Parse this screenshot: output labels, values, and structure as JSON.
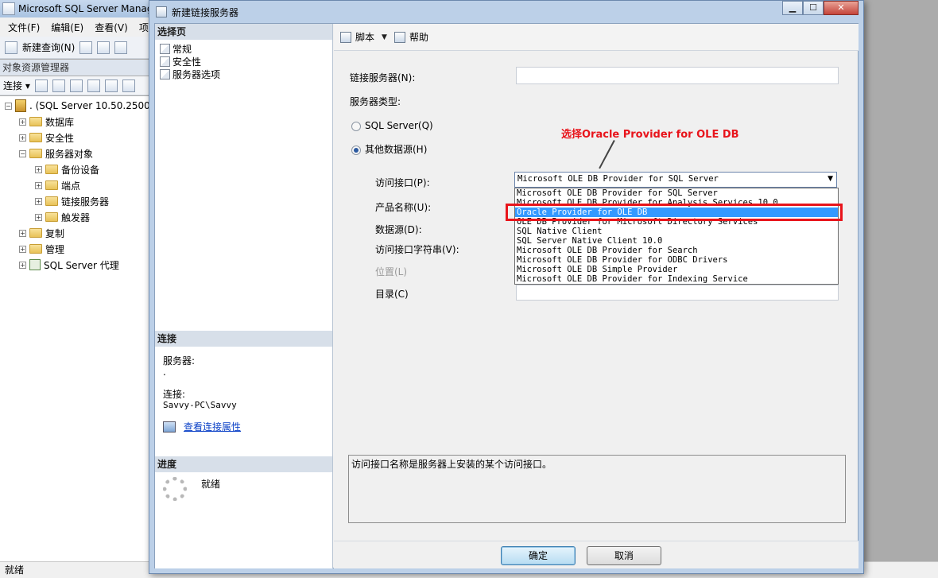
{
  "ssms": {
    "title": "Microsoft SQL Server Manag",
    "menu": [
      "文件(F)",
      "编辑(E)",
      "查看(V)",
      "项"
    ],
    "toolbar_new_query": "新建查询(N)",
    "object_explorer_title": "对象资源管理器",
    "connect_label": "连接",
    "tree": {
      "server": ". (SQL Server 10.50.2500",
      "databases": "数据库",
      "security": "安全性",
      "server_objects": "服务器对象",
      "backup_devices": "备份设备",
      "endpoints": "端点",
      "linked_servers": "链接服务器",
      "triggers": "触发器",
      "replication": "复制",
      "management": "管理",
      "agent": "SQL Server 代理"
    },
    "status": "就绪"
  },
  "dialog": {
    "title": "新建链接服务器",
    "left": {
      "select_page_header": "选择页",
      "pages": [
        "常规",
        "安全性",
        "服务器选项"
      ],
      "connection_header": "连接",
      "server_label": "服务器:",
      "server_value": ".",
      "connection_label": "连接:",
      "connection_value": "Savvy-PC\\Savvy",
      "view_props_link": "查看连接属性",
      "progress_header": "进度",
      "progress_status": "就绪"
    },
    "toolbar": {
      "script": "脚本",
      "help": "帮助"
    },
    "form": {
      "linked_server_label": "链接服务器(N):",
      "server_type_label": "服务器类型:",
      "radio_sql_server": "SQL Server(Q)",
      "radio_other": "其他数据源(H)",
      "provider_label": "访问接口(P):",
      "product_name_label": "产品名称(U):",
      "data_source_label": "数据源(D):",
      "provider_string_label": "访问接口字符串(V):",
      "location_label": "位置(L)",
      "catalog_label": "目录(C)",
      "provider_selected": "Microsoft OLE DB Provider for SQL Server",
      "provider_options": [
        "Microsoft OLE DB Provider for SQL Server",
        "Microsoft OLE DB Provider for Analysis Services 10.0",
        "Oracle Provider for OLE DB",
        "OLE DB Provider for Microsoft Directory Services",
        "SQL Native Client",
        "SQL Server Native Client 10.0",
        "Microsoft OLE DB Provider for Search",
        "Microsoft OLE DB Provider for ODBC Drivers",
        "Microsoft OLE DB Simple Provider",
        "Microsoft OLE DB Provider for Indexing Service"
      ],
      "highlighted_index": 2
    },
    "annotation": "选择Oracle Provider for OLE  DB",
    "description": "访问接口名称是服务器上安装的某个访问接口。",
    "buttons": {
      "ok": "确定",
      "cancel": "取消"
    }
  },
  "colors": {
    "annotation_red": "#e8141b",
    "selection_blue": "#3399ff",
    "link_blue": "#0b41c7"
  }
}
